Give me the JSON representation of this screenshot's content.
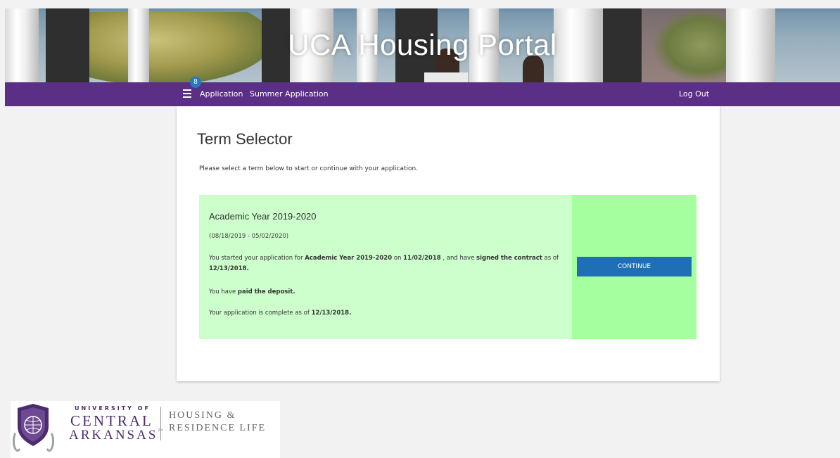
{
  "header": {
    "title": "UCA Housing Portal"
  },
  "nav": {
    "badge_count": "8",
    "items": [
      {
        "label": "Application"
      },
      {
        "label": "Summer Application"
      }
    ],
    "logout_label": "Log Out"
  },
  "main": {
    "title": "Term Selector",
    "instructions": "Please select a term below to start or continue with your application.",
    "term": {
      "name": "Academic Year 2019-2020",
      "dates": "(08/18/2019 - 05/02/2020)",
      "started_prefix": "You started your application for ",
      "started_term": "Academic Year 2019-2020",
      "started_on": " on ",
      "started_date": "11/02/2018",
      "contract_mid": " , and have ",
      "contract_bold": "signed the contract",
      "contract_as_of": " as of ",
      "contract_date": "12/13/2018.",
      "deposit_prefix": "You have ",
      "deposit_bold": "paid the deposit.",
      "complete_prefix": "Your application is complete as of ",
      "complete_date": "12/13/2018.",
      "button_label": "CONTINUE"
    }
  },
  "footer": {
    "logo_line1": "UNIVERSITY OF",
    "logo_line2": "CENTRAL",
    "logo_line3": "ARKANSAS",
    "logo_tm": "™",
    "dept_line1": "HOUSING &",
    "dept_line2": "RESIDENCE LIFE"
  },
  "colors": {
    "nav": "#5b2f86",
    "badge": "#2479bd",
    "term_bg": "#ccffcc",
    "term_action_bg": "#a6ff9e",
    "button": "#1f6fb5"
  }
}
